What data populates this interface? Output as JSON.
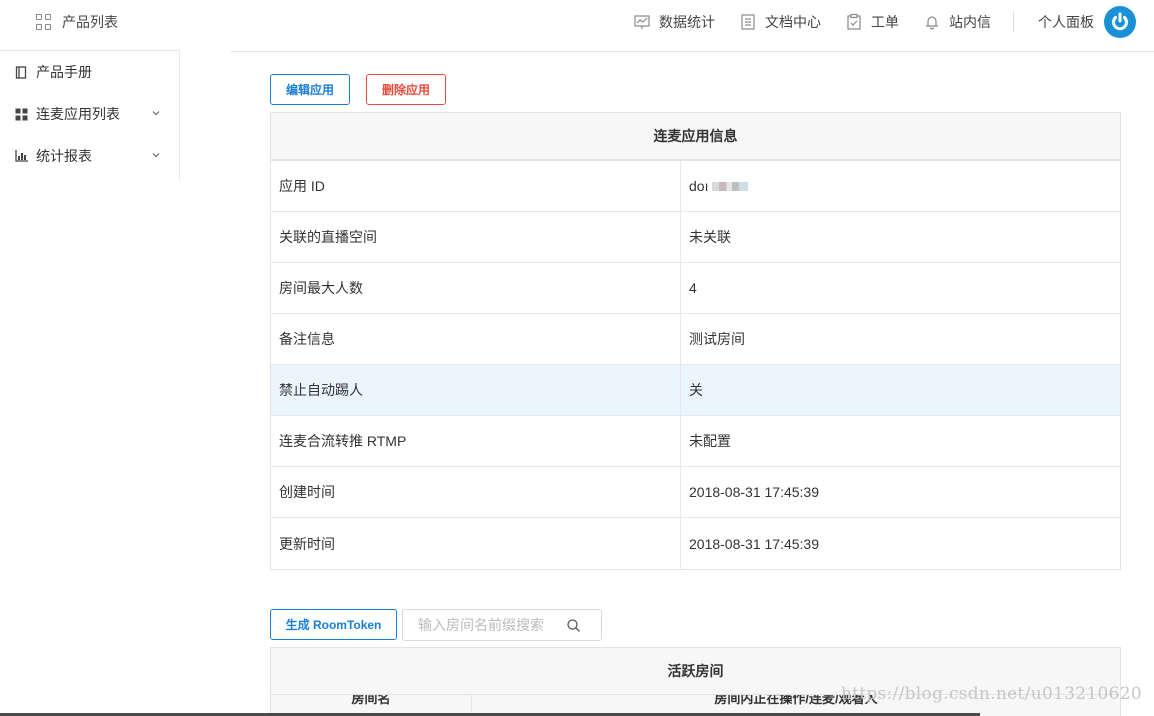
{
  "topbar": {
    "product_list": "产品列表",
    "nav": [
      {
        "label": "数据统计",
        "icon": "chart-board-icon"
      },
      {
        "label": "文档中心",
        "icon": "document-icon"
      },
      {
        "label": "工单",
        "icon": "clipboard-icon"
      },
      {
        "label": "站内信",
        "icon": "bell-icon"
      }
    ],
    "personal_panel": "个人面板"
  },
  "sidebar": {
    "items": [
      {
        "label": "产品手册",
        "icon": "book-icon"
      },
      {
        "label": "连麦应用列表",
        "icon": "grid-icon"
      },
      {
        "label": "统计报表",
        "icon": "bar-chart-icon"
      }
    ]
  },
  "actions": {
    "edit": "编辑应用",
    "delete": "删除应用"
  },
  "info": {
    "title": "连麦应用信息",
    "rows": [
      {
        "key": "应用 ID",
        "value": "doı"
      },
      {
        "key": "关联的直播空间",
        "value": "未关联"
      },
      {
        "key": "房间最大人数",
        "value": "4"
      },
      {
        "key": "备注信息",
        "value": "测试房间"
      },
      {
        "key": "禁止自动踢人",
        "value": "关"
      },
      {
        "key": "连麦合流转推 RTMP",
        "value": "未配置"
      },
      {
        "key": "创建时间",
        "value": "2018-08-31 17:45:39"
      },
      {
        "key": "更新时间",
        "value": "2018-08-31 17:45:39"
      }
    ]
  },
  "rooms": {
    "generate_token": "生成 RoomToken",
    "search_placeholder": "输入房间名前缀搜索",
    "title": "活跃房间",
    "columns": [
      "房间名",
      "房间内正在操作/连麦/观看人"
    ]
  },
  "watermark": "https://blog.csdn.net/u013210620",
  "colors": {
    "accent": "#1a7fd4",
    "danger": "#e74c3c",
    "highlight_row": "#eaf5fd"
  }
}
